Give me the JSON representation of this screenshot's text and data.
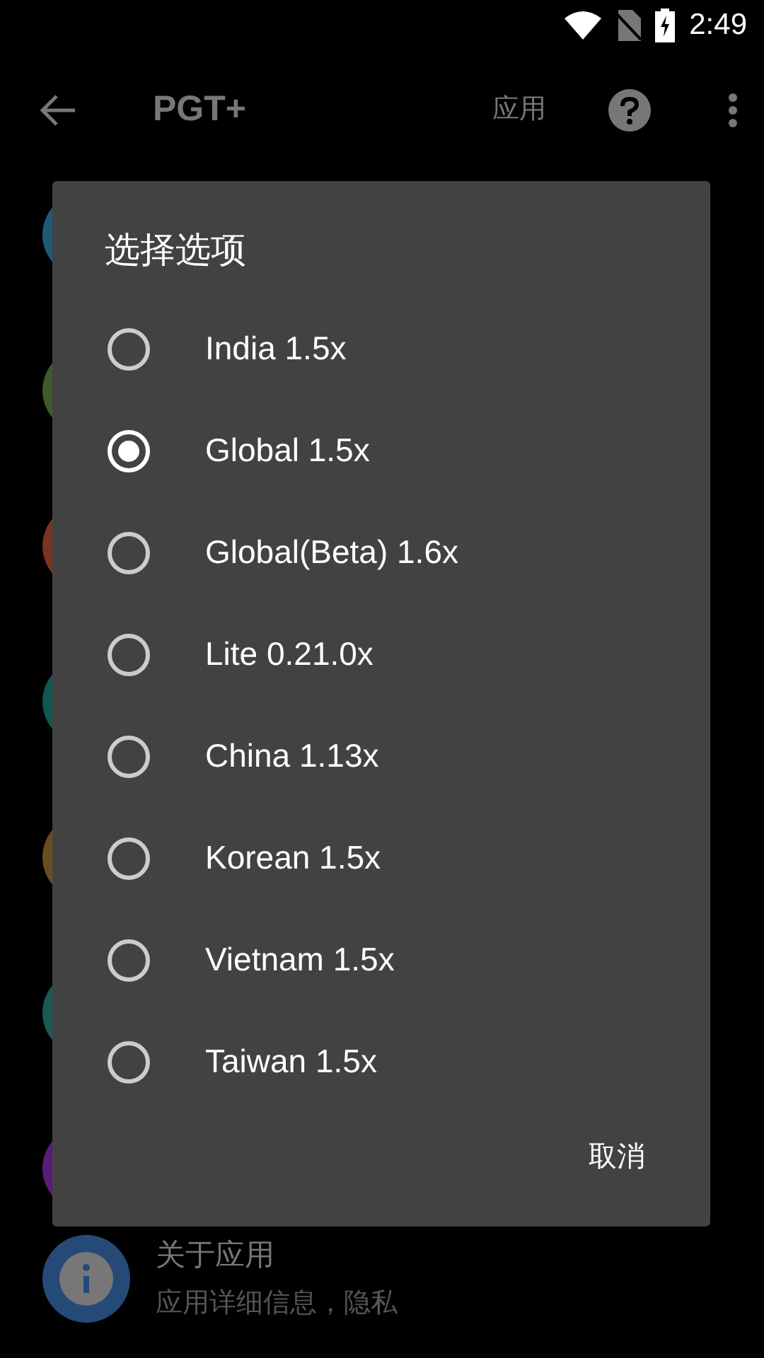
{
  "status_bar": {
    "time": "2:49"
  },
  "toolbar": {
    "title": "PGT+",
    "action": "应用"
  },
  "background_items": [
    {
      "color": "#1d5a78"
    },
    {
      "color": "#3d5a2a"
    },
    {
      "color": "#7a3422"
    },
    {
      "color": "#115650"
    },
    {
      "color": "#6a4c22"
    },
    {
      "color": "#1a5a55"
    },
    {
      "color": "#5a1c78"
    }
  ],
  "dialog": {
    "title": "选择选项",
    "options": [
      {
        "label": "India 1.5x",
        "selected": false
      },
      {
        "label": "Global 1.5x",
        "selected": true
      },
      {
        "label": "Global(Beta) 1.6x",
        "selected": false
      },
      {
        "label": "Lite 0.21.0x",
        "selected": false
      },
      {
        "label": "China 1.13x",
        "selected": false
      },
      {
        "label": "Korean 1.5x",
        "selected": false
      },
      {
        "label": "Vietnam 1.5x",
        "selected": false
      },
      {
        "label": "Taiwan 1.5x",
        "selected": false
      }
    ],
    "cancel": "取消"
  },
  "about_item": {
    "title": "关于应用",
    "subtitle": "应用详细信息，隐私"
  }
}
